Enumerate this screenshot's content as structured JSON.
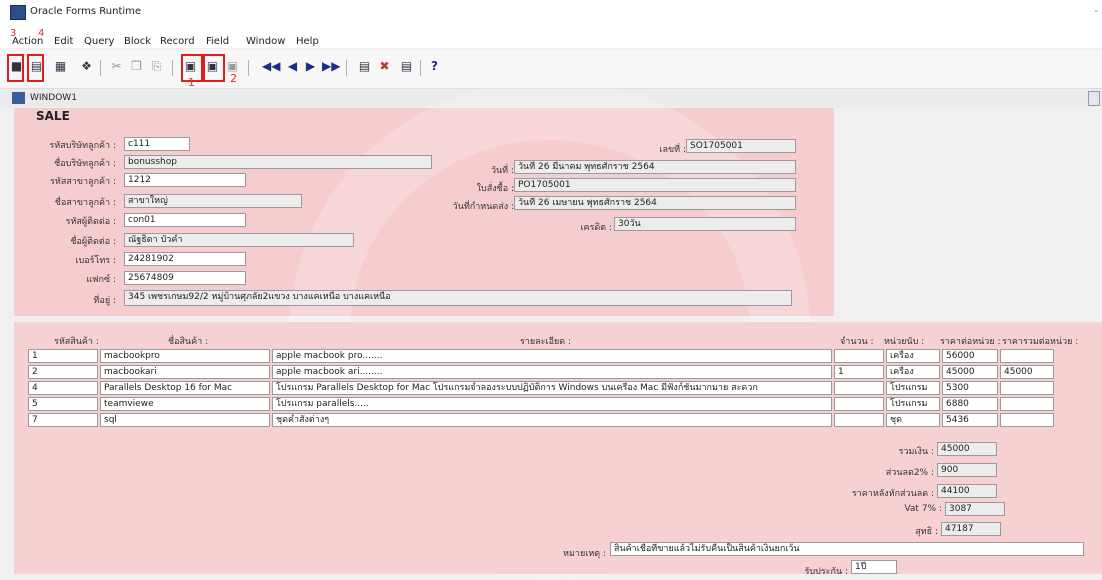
{
  "window_title": "Oracle Forms Runtime",
  "menu": {
    "items": [
      "Action",
      "Edit",
      "Query",
      "Block",
      "Record",
      "Field",
      "Window",
      "Help"
    ],
    "red_marks": [
      "3",
      "4"
    ]
  },
  "toolbar": {
    "icons": [
      "save-icon",
      "print-icon",
      "clear-icon",
      "exit-icon",
      "cut-icon",
      "copy-icon",
      "paste-icon",
      "execute-query-icon",
      "enter-query-icon",
      "cancel-query-icon",
      "first-record-icon",
      "prev-record-icon",
      "next-record-icon",
      "last-record-icon",
      "insert-record-icon",
      "delete-record-icon",
      "lock-record-icon",
      "help-icon"
    ],
    "red_numbers": [
      "1",
      "2"
    ]
  },
  "window": {
    "name": "WINDOW1",
    "section": "SALE"
  },
  "customer": {
    "code_label": "รหัสบริษัทลูกค้า :",
    "code": "c111",
    "name_label": "ชื่อบริษัทลูกค้า :",
    "name": "bonusshop",
    "branch_code_label": "รหัสสาขาลูกค้า :",
    "branch_code": "1212",
    "branch_name_label": "ชื่อสาขาลูกค้า :",
    "branch_name": "สาขาใหญ่",
    "contact_code_label": "รหัสผู้ติดต่อ :",
    "contact_code": "con01",
    "contact_name_label": "ชื่อผู้ติดต่อ :",
    "contact_name": "ณัฐธิดา บัวคำ",
    "phone_label": "เบอร์โทร :",
    "phone": "24281902",
    "fax_label": "แฟกซ์ :",
    "fax": "25674809",
    "address_label": "ที่อยู่ :",
    "address": "345 เพชรเกษม92/2 หมู่บ้านศุภลัย2แขวง บางแคเหนือ บางแคเหนือ"
  },
  "document": {
    "number_label": "เลขที่ :",
    "number": "SO1705001",
    "date_label": "วันที่ :",
    "date": "วันที่ 26 มีนาคม พุทธศักราช 2564",
    "quote_label": "ใบสั่งซื้อ :",
    "quote": "PO1705001",
    "due_label": "วันที่กำหนดส่ง :",
    "due": "วันที่ 26 เมษายน พุทธศักราช 2564",
    "credit_label": "เครดิต :",
    "credit": "30วัน"
  },
  "items_table": {
    "headers": [
      "รหัสสินค้า :",
      "ชื่อสินค้า :",
      "รายละเอียด :",
      "จำนวน :",
      "หน่วยนับ :",
      "ราคาต่อหน่วย :",
      "ราคารวมต่อหน่วย :"
    ],
    "rows": [
      [
        "1",
        "macbookpro",
        "apple macbook pro.......",
        "",
        "เครื่อง",
        "56000",
        ""
      ],
      [
        "2",
        "macbookari",
        "apple macbook ari........",
        "1",
        "เครื่อง",
        "45000",
        "45000"
      ],
      [
        "4",
        "Parallels Desktop 16 for Mac",
        "โปรแกรม Parallels Desktop for Mac โปรแกรมจำลองระบบปฏิบัติการ Windows บนเครื่อง Mac มีฟังก์ชั่นมากมาย สะดวก",
        "",
        "โปรแกรม",
        "5300",
        ""
      ],
      [
        "5",
        "teamviewe",
        "โปรแกรม parallels.....",
        "",
        "โปรแกรม",
        "6880",
        ""
      ],
      [
        "7",
        "sql",
        "ชุดคำสั่งต่างๆ",
        "",
        "ชุด",
        "5436",
        ""
      ]
    ]
  },
  "totals": {
    "sum_label": "รวมเงิน :",
    "sum": "45000",
    "discount_label": "ส่วนลด2% :",
    "discount": "900",
    "after_discount_label": "ราคาหลังหักส่วนลด :",
    "after_discount": "44100",
    "vat_label": "Vat 7% :",
    "vat": "3087",
    "net_label": "สุทธิ :",
    "net": "47187"
  },
  "footer": {
    "note_label": "หมายเหตุ :",
    "note": "สินค้าเชื่อที่ขายแล้วไม่รับคืนเป็นสินค้าเงินยกเว้น",
    "approve_label": "รับประกัน :",
    "approve": "1ปี"
  },
  "colors": {
    "panel": "#f6cdcf",
    "annotation_red": "#e01e1e",
    "field_bg": "#ffffff"
  }
}
